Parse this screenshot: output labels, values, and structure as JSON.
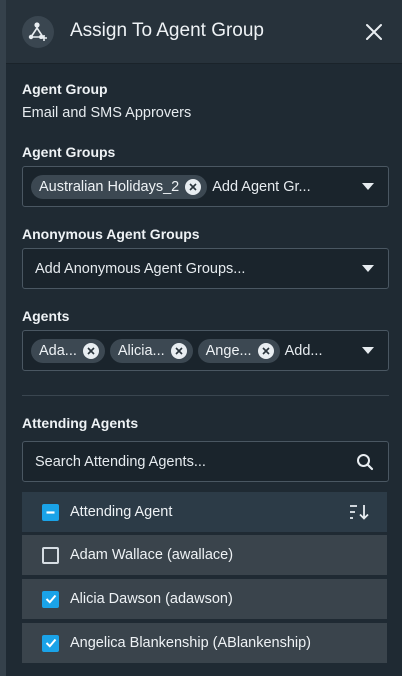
{
  "header": {
    "title": "Assign To Agent Group",
    "app_icon": "agent-group-add-icon",
    "close_icon": "close-icon"
  },
  "agent_group": {
    "label": "Agent Group",
    "value": "Email and SMS Approvers"
  },
  "agent_groups": {
    "label": "Agent Groups",
    "chips": [
      "Australian Holidays_2"
    ],
    "placeholder": "Add Agent Gr..."
  },
  "anonymous_agent_groups": {
    "label": "Anonymous Agent Groups",
    "placeholder": "Add Anonymous Agent Groups..."
  },
  "agents": {
    "label": "Agents",
    "chips": [
      "Ada...",
      "Alicia...",
      "Ange..."
    ],
    "placeholder": "Add..."
  },
  "attending_agents": {
    "label": "Attending Agents",
    "search_placeholder": "Search Attending Agents...",
    "column_header": "Attending Agent",
    "rows": [
      {
        "name": "Adam Wallace (awallace)",
        "checked": false
      },
      {
        "name": "Alicia Dawson (adawson)",
        "checked": true
      },
      {
        "name": "Angelica Blankenship (ABlankenship)",
        "checked": true
      }
    ]
  },
  "colors": {
    "background": "#1f2a33",
    "accent": "#1aa3e8",
    "field_bg": "#1a242c",
    "chip_bg": "#3c4852"
  }
}
